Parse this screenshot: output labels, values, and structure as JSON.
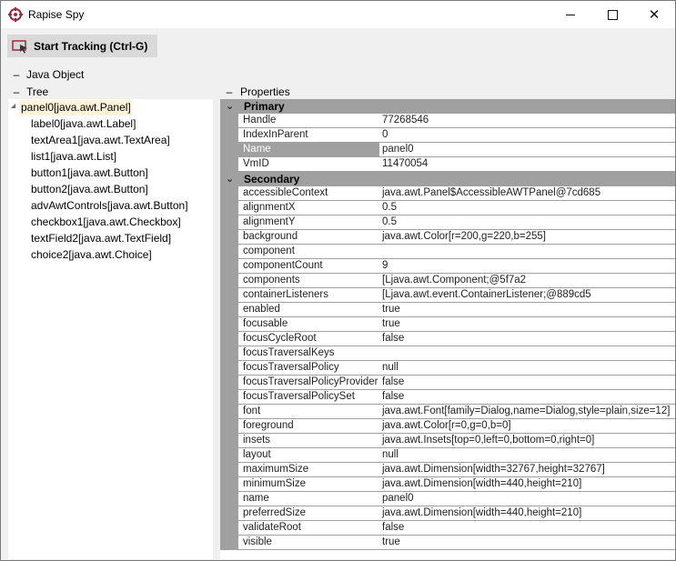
{
  "window": {
    "title": "Rapise Spy",
    "minimize_icon": "minimize-icon",
    "maximize_icon": "maximize-icon",
    "close_icon": "close-icon"
  },
  "toolbar": {
    "start_tracking_label": "Start Tracking (Ctrl-G)"
  },
  "sections": {
    "java_object": "Java Object",
    "tree": "Tree",
    "properties": "Properties",
    "collapse_glyph": "–"
  },
  "tree": {
    "items": [
      "panel0[java.awt.Panel]",
      "label0[java.awt.Label]",
      "textArea1[java.awt.TextArea]",
      "list1[java.awt.List]",
      "button1[java.awt.Button]",
      "button2[java.awt.Button]",
      "advAwtControls[java.awt.Button]",
      "checkbox1[java.awt.Checkbox]",
      "textField2[java.awt.TextField]",
      "choice2[java.awt.Choice]"
    ]
  },
  "properties": {
    "primary": {
      "label": "Primary",
      "rows": [
        {
          "name": "Handle",
          "value": "77268546"
        },
        {
          "name": "IndexInParent",
          "value": "0"
        },
        {
          "name": "Name",
          "value": "panel0"
        },
        {
          "name": "VmID",
          "value": "11470054"
        }
      ]
    },
    "secondary": {
      "label": "Secondary",
      "rows": [
        {
          "name": "accessibleContext",
          "value": "java.awt.Panel$AccessibleAWTPanel@7cd685"
        },
        {
          "name": "alignmentX",
          "value": "0.5"
        },
        {
          "name": "alignmentY",
          "value": "0.5"
        },
        {
          "name": "background",
          "value": "java.awt.Color[r=200,g=220,b=255]"
        },
        {
          "name": "component",
          "value": ""
        },
        {
          "name": "componentCount",
          "value": "9"
        },
        {
          "name": "components",
          "value": "[Ljava.awt.Component;@5f7a2"
        },
        {
          "name": "containerListeners",
          "value": "[Ljava.awt.event.ContainerListener;@889cd5"
        },
        {
          "name": "enabled",
          "value": "true"
        },
        {
          "name": "focusable",
          "value": "true"
        },
        {
          "name": "focusCycleRoot",
          "value": "false"
        },
        {
          "name": "focusTraversalKeys",
          "value": ""
        },
        {
          "name": "focusTraversalPolicy",
          "value": "null"
        },
        {
          "name": "focusTraversalPolicyProvider",
          "value": "false"
        },
        {
          "name": "focusTraversalPolicySet",
          "value": "false"
        },
        {
          "name": "font",
          "value": "java.awt.Font[family=Dialog,name=Dialog,style=plain,size=12]"
        },
        {
          "name": "foreground",
          "value": "java.awt.Color[r=0,g=0,b=0]"
        },
        {
          "name": "insets",
          "value": "java.awt.Insets[top=0,left=0,bottom=0,right=0]"
        },
        {
          "name": "layout",
          "value": "null"
        },
        {
          "name": "maximumSize",
          "value": "java.awt.Dimension[width=32767,height=32767]"
        },
        {
          "name": "minimumSize",
          "value": "java.awt.Dimension[width=440,height=210]"
        },
        {
          "name": "name",
          "value": "panel0"
        },
        {
          "name": "preferredSize",
          "value": "java.awt.Dimension[width=440,height=210]"
        },
        {
          "name": "validateRoot",
          "value": "false"
        },
        {
          "name": "visible",
          "value": "true"
        }
      ]
    }
  },
  "colors": {
    "selection_bg": "#fff3d9",
    "grid_gutter": "#a0a0a0",
    "toolbar_button_bg": "#d9d9d9",
    "app_icon": "#a0283c"
  }
}
